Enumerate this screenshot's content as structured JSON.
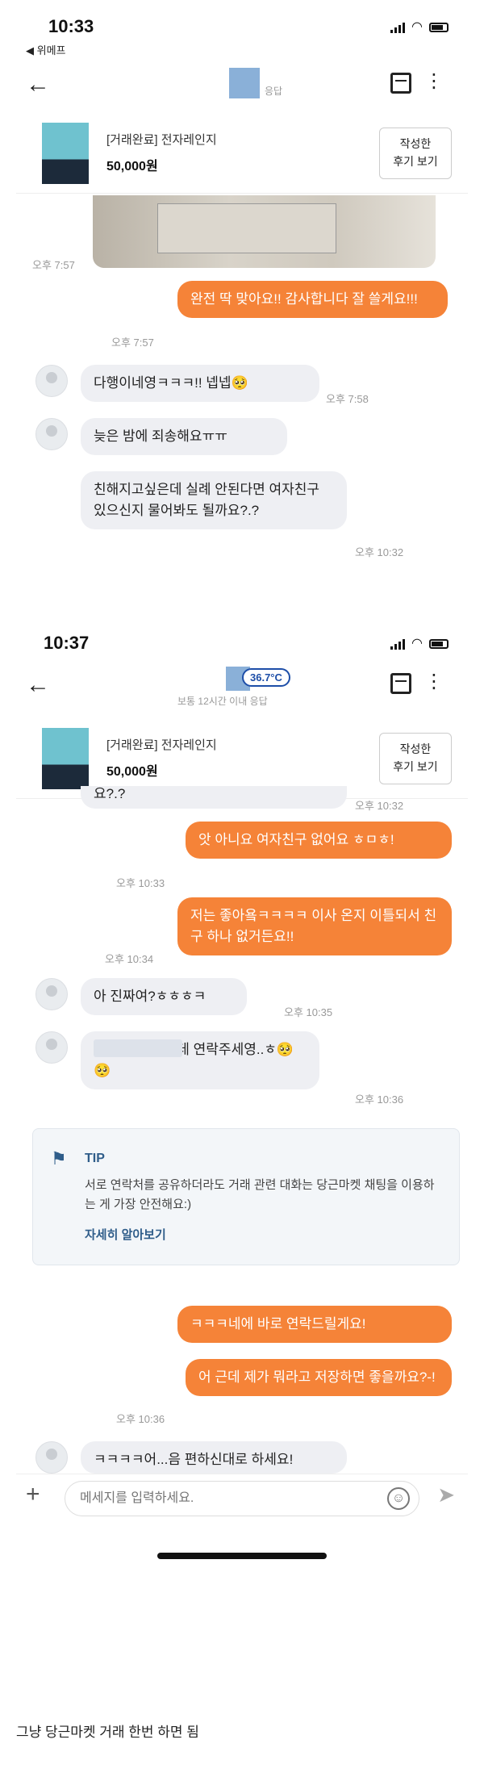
{
  "shot1": {
    "time": "10:33",
    "back_app": "◀ 위메프",
    "resp_label": "응답"
  },
  "shot2": {
    "time": "10:37",
    "temperature": "36.7°C",
    "resp_label": "보통 12시간 이내 응답"
  },
  "product": {
    "status": "[거래완료] 전자레인지",
    "price": "50,000원",
    "review_btn_line1": "작성한",
    "review_btn_line2": "후기 보기"
  },
  "chat1": [
    {
      "type": "time",
      "text": "오후 7:57"
    },
    {
      "type": "out",
      "text": "완전 딱 맞아요!! 감사합니다 잘 쓸게요!!!",
      "time": "오후 7:57"
    },
    {
      "type": "in",
      "text": "다행이네영ㅋㅋㅋ!! 넵넵🥺",
      "time": "오후 7:58"
    },
    {
      "type": "in",
      "text": "늦은 밤에 죄송해요ㅠㅠ"
    },
    {
      "type": "in",
      "text": "친해지고싶은데 실례 안된다면 여자친구 있으신지 물어봐도 될까요?.?",
      "time": "오후 10:32"
    }
  ],
  "chat2": [
    {
      "type": "in",
      "text": "요?.?",
      "time": "오후 10:32"
    },
    {
      "type": "out",
      "text": "앗 아니요 여자친구 없어요 ㅎㅁㅎ!",
      "time": "오후 10:33"
    },
    {
      "type": "out",
      "text": "저는 좋아욬ㅋㅋㅋㅋ 이사 온지 이틀되서 친구 하나 없거든요!!",
      "time": "오후 10:34"
    },
    {
      "type": "in",
      "text": "아 진짜여?ㅎㅎㅎㅋ",
      "time": "오후 10:35"
    },
    {
      "type": "in",
      "text": "이거 제 번호인데 연락주세영..ㅎ🥺🥺",
      "time": "오후 10:36"
    },
    {
      "type": "out",
      "text": "ㅋㅋㅋ네에 바로 연락드릴게요!"
    },
    {
      "type": "out",
      "text": "어 근데 제가 뭐라고 저장하면 좋을까요?-!",
      "time": "오후 10:36"
    },
    {
      "type": "in",
      "text": "ㅋㅋㅋㅋ어...음 편하신대로 하세요!"
    }
  ],
  "tip": {
    "title": "TIP",
    "body": "서로 연락처를 공유하더라도 거래 관련 대화는 당근마켓 채팅을 이용하는 게 가장 안전해요:)",
    "link": "자세히 알아보기"
  },
  "composer": {
    "placeholder": "메세지를 입력하세요.",
    "plus": "+",
    "send": "➤",
    "emoji": "☺"
  },
  "icons": {
    "back": "back-arrow-icon",
    "calendar": "calendar-icon",
    "more": "more-vertical-icon",
    "tip": "flag-icon"
  },
  "caption": "그냥 당근마켓 거래 한번 하면 됨",
  "colors": {
    "outgoing": "#f58338",
    "incoming": "#eeeff3",
    "tip_accent": "#2f5d8a",
    "temp": "#1d4ea8"
  }
}
